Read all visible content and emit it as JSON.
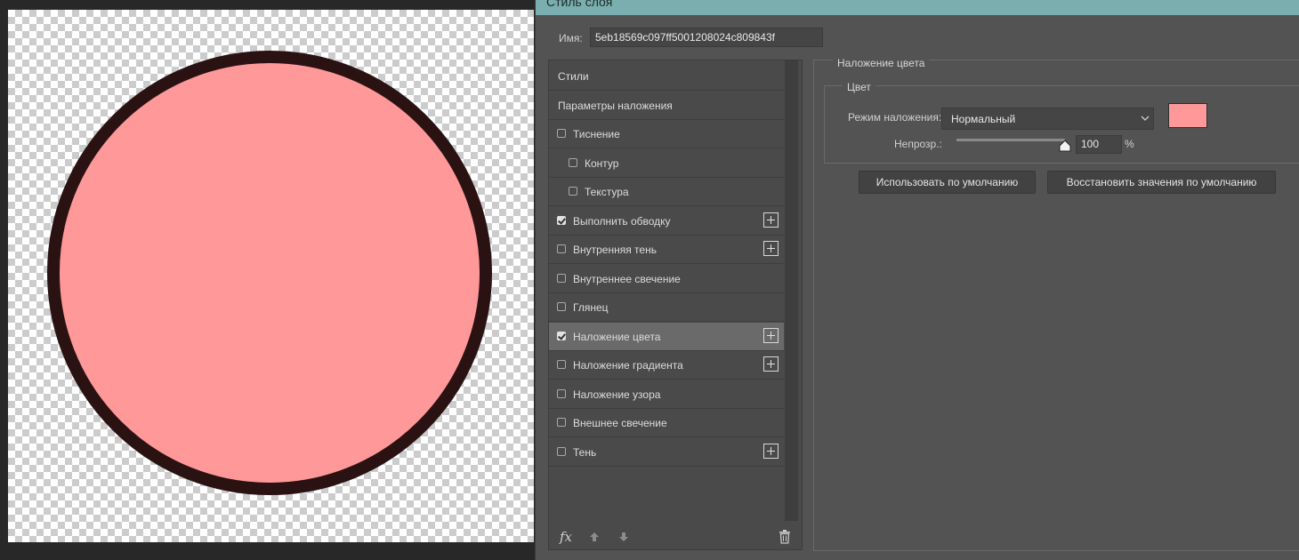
{
  "dialog": {
    "title": "Стиль слоя",
    "name_label": "Имя:",
    "name_value": "5eb18569c097ff5001208024c809843f"
  },
  "styles_list": {
    "items": [
      {
        "label": "Стили",
        "checkbox": false,
        "checked": false,
        "indent": false,
        "plus": false,
        "active": false
      },
      {
        "label": "Параметры наложения",
        "checkbox": false,
        "checked": false,
        "indent": false,
        "plus": false,
        "active": false
      },
      {
        "label": "Тиснение",
        "checkbox": true,
        "checked": false,
        "indent": false,
        "plus": false,
        "active": false
      },
      {
        "label": "Контур",
        "checkbox": true,
        "checked": false,
        "indent": true,
        "plus": false,
        "active": false
      },
      {
        "label": "Текстура",
        "checkbox": true,
        "checked": false,
        "indent": true,
        "plus": false,
        "active": false
      },
      {
        "label": "Выполнить обводку",
        "checkbox": true,
        "checked": true,
        "indent": false,
        "plus": true,
        "active": false
      },
      {
        "label": "Внутренняя тень",
        "checkbox": true,
        "checked": false,
        "indent": false,
        "plus": true,
        "active": false
      },
      {
        "label": "Внутреннее свечение",
        "checkbox": true,
        "checked": false,
        "indent": false,
        "plus": false,
        "active": false
      },
      {
        "label": "Глянец",
        "checkbox": true,
        "checked": false,
        "indent": false,
        "plus": false,
        "active": false
      },
      {
        "label": "Наложение цвета",
        "checkbox": true,
        "checked": true,
        "indent": false,
        "plus": true,
        "active": true
      },
      {
        "label": "Наложение градиента",
        "checkbox": true,
        "checked": false,
        "indent": false,
        "plus": true,
        "active": false
      },
      {
        "label": "Наложение узора",
        "checkbox": true,
        "checked": false,
        "indent": false,
        "plus": false,
        "active": false
      },
      {
        "label": "Внешнее свечение",
        "checkbox": true,
        "checked": false,
        "indent": false,
        "plus": false,
        "active": false
      },
      {
        "label": "Тень",
        "checkbox": true,
        "checked": false,
        "indent": false,
        "plus": true,
        "active": false
      }
    ],
    "footer_icons": [
      "fx-icon",
      "move-up-icon",
      "move-down-icon",
      "trash-icon"
    ],
    "fx_label": "fx"
  },
  "color_overlay": {
    "section_title": "Наложение цвета",
    "group_title": "Цвет",
    "blend_mode_label": "Режим наложения:",
    "blend_mode_value": "Нормальный",
    "opacity_label": "Непрозр.:",
    "opacity_value": "100",
    "opacity_unit": "%",
    "opacity_level": 1.0,
    "swatch_color": "#ff9999",
    "make_default_label": "Использовать по умолчанию",
    "reset_default_label": "Восстановить значения по умолчанию"
  },
  "canvas": {
    "fill_color": "#ff9999",
    "stroke_color": "#2a1213"
  },
  "colors": {
    "titlebar": "#7baeae",
    "dialog_bg": "#535353",
    "active_item": "#6a6a6a"
  }
}
